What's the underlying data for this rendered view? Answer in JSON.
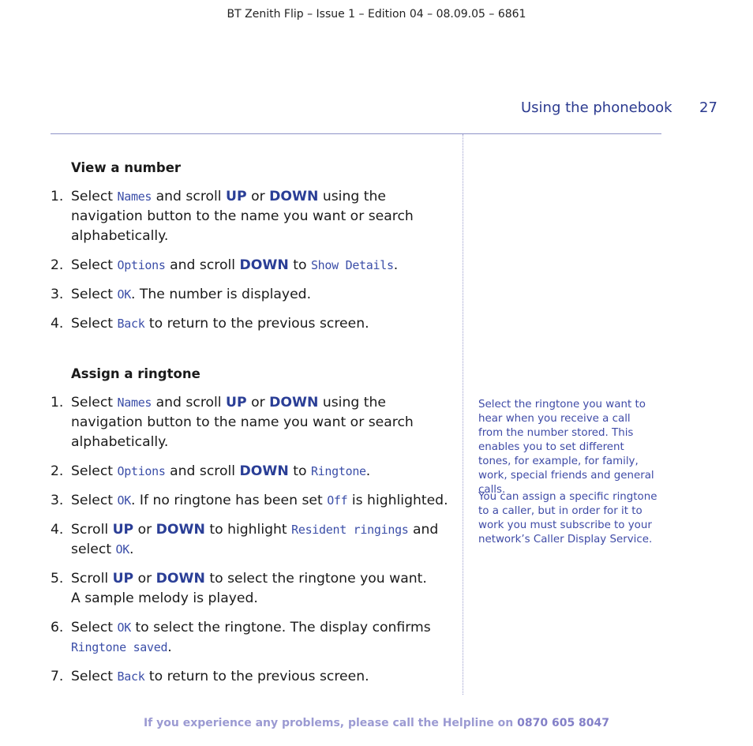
{
  "header": {
    "doc_info": "BT Zenith Flip – Issue 1 – Edition 04 – 08.09.05 – 6861",
    "section_title": "Using the phonebook",
    "page_number": "27"
  },
  "view_number": {
    "heading": "View a number",
    "steps": [
      {
        "num": "1.",
        "parts": [
          {
            "t": "Select "
          },
          {
            "t": "Names",
            "s": "lcd"
          },
          {
            "t": " and scroll "
          },
          {
            "t": "UP",
            "s": "kw"
          },
          {
            "t": " or "
          },
          {
            "t": "DOWN",
            "s": "kw"
          },
          {
            "t": " using the navigation button to the name you want or search alphabetically."
          }
        ]
      },
      {
        "num": "2.",
        "parts": [
          {
            "t": "Select "
          },
          {
            "t": "Options",
            "s": "lcd"
          },
          {
            "t": " and scroll "
          },
          {
            "t": "DOWN",
            "s": "kw"
          },
          {
            "t": " to "
          },
          {
            "t": "Show Details",
            "s": "lcd"
          },
          {
            "t": "."
          }
        ]
      },
      {
        "num": "3.",
        "parts": [
          {
            "t": "Select "
          },
          {
            "t": "OK",
            "s": "lcd"
          },
          {
            "t": ". The number is displayed."
          }
        ]
      },
      {
        "num": "4.",
        "parts": [
          {
            "t": "Select "
          },
          {
            "t": "Back",
            "s": "lcd"
          },
          {
            "t": " to return to the previous screen."
          }
        ]
      }
    ]
  },
  "assign_ringtone": {
    "heading": "Assign a ringtone",
    "steps": [
      {
        "num": "1.",
        "parts": [
          {
            "t": "Select "
          },
          {
            "t": "Names",
            "s": "lcd"
          },
          {
            "t": " and scroll "
          },
          {
            "t": "UP",
            "s": "kw"
          },
          {
            "t": " or "
          },
          {
            "t": "DOWN",
            "s": "kw"
          },
          {
            "t": " using the navigation button to the name you want or search alphabetically."
          }
        ]
      },
      {
        "num": "2.",
        "parts": [
          {
            "t": "Select "
          },
          {
            "t": "Options",
            "s": "lcd"
          },
          {
            "t": " and scroll "
          },
          {
            "t": "DOWN",
            "s": "kw"
          },
          {
            "t": " to "
          },
          {
            "t": "Ringtone",
            "s": "lcd"
          },
          {
            "t": "."
          }
        ]
      },
      {
        "num": "3.",
        "parts": [
          {
            "t": "Select "
          },
          {
            "t": "OK",
            "s": "lcd"
          },
          {
            "t": ". If no ringtone has been set "
          },
          {
            "t": "Off",
            "s": "lcd"
          },
          {
            "t": " is highlighted."
          }
        ]
      },
      {
        "num": "4.",
        "parts": [
          {
            "t": "Scroll "
          },
          {
            "t": "UP",
            "s": "kw"
          },
          {
            "t": " or "
          },
          {
            "t": "DOWN",
            "s": "kw"
          },
          {
            "t": " to highlight "
          },
          {
            "t": "Resident ringings",
            "s": "lcd"
          },
          {
            "t": " and select "
          },
          {
            "t": "OK",
            "s": "lcd"
          },
          {
            "t": "."
          }
        ]
      },
      {
        "num": "5.",
        "parts": [
          {
            "t": "Scroll "
          },
          {
            "t": "UP",
            "s": "kw"
          },
          {
            "t": " or "
          },
          {
            "t": "DOWN",
            "s": "kw"
          },
          {
            "t": " to select the ringtone you want."
          },
          {
            "br": true
          },
          {
            "t": "A sample melody is played."
          }
        ]
      },
      {
        "num": "6.",
        "parts": [
          {
            "t": "Select "
          },
          {
            "t": "OK",
            "s": "lcd"
          },
          {
            "t": " to select the ringtone. The display confirms "
          },
          {
            "t": "Ringtone saved",
            "s": "lcd"
          },
          {
            "t": "."
          }
        ]
      },
      {
        "num": "7.",
        "parts": [
          {
            "t": "Select "
          },
          {
            "t": "Back",
            "s": "lcd"
          },
          {
            "t": " to return to the previous screen."
          }
        ]
      }
    ]
  },
  "sidebar": {
    "note_1": "Select the ringtone you want to hear when you receive a call from the number stored. This enables you to set different tones, for example, for family, work, special friends and general calls.",
    "note_2": "You can assign a specific ringtone to a caller, but in order for it to work you must subscribe to your network’s Caller Display Service."
  },
  "footer": {
    "text": "If you experience any problems, please call the Helpline on ",
    "phone": "0870 605 8047"
  },
  "colors": {
    "accent": "#2b3a8f",
    "keyword": "#2a3e96",
    "lcd_text": "#3b4ea8",
    "footer": "#9b9ad2"
  }
}
